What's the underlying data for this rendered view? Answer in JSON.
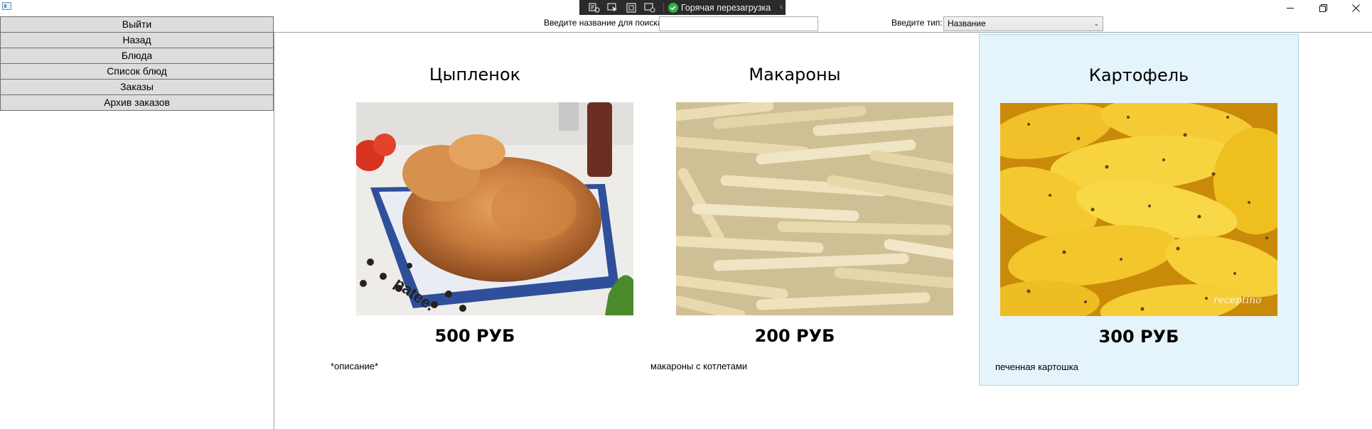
{
  "window": {
    "controls": {
      "minimize": "—",
      "maximize": "❐",
      "close": "✕"
    }
  },
  "debug_toolbar": {
    "hot_reload_label": "Горячая перезагрузка",
    "tools": [
      "live-visual-tree-icon",
      "select-element-icon",
      "display-adorners-icon",
      "track-focus-icon"
    ],
    "status_color": "#32b247"
  },
  "search": {
    "label": "Введите название для поиска",
    "value": "",
    "type_label": "Введите тип:",
    "type_selected": "Название"
  },
  "nav": {
    "items": [
      {
        "label": "Выйти"
      },
      {
        "label": "Назад"
      },
      {
        "label": "Блюда"
      },
      {
        "label": "Список блюд"
      },
      {
        "label": "Заказы"
      },
      {
        "label": "Архив заказов"
      }
    ]
  },
  "dishes": [
    {
      "name": "Цыпленок",
      "price": "500 РУБ",
      "description": "*описание*",
      "image": "roast-chicken-photo",
      "image_text": "patee."
    },
    {
      "name": "Макароны",
      "price": "200 РУБ",
      "description": "макароны с котлетами",
      "image": "pasta-photo"
    },
    {
      "name": "Картофель",
      "price": "300 РУБ",
      "description": "печенная картошка",
      "image": "baked-potato-photo",
      "image_text": "receptino",
      "selected": true
    }
  ],
  "colors": {
    "selection_bg": "#e5f3fb",
    "selection_border": "#a9d5f2",
    "nav_button_bg": "#dddddd"
  }
}
